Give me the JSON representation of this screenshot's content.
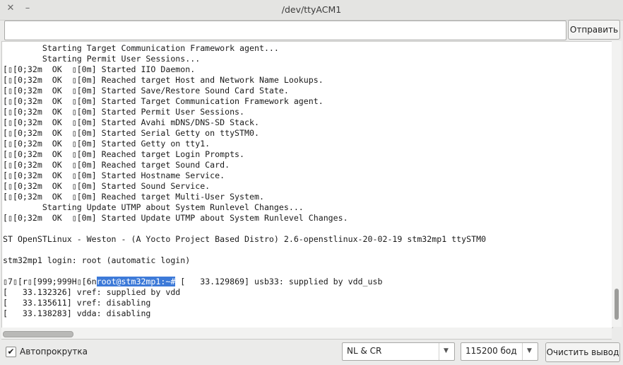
{
  "window": {
    "title": "/dev/ttyACM1",
    "close_glyph": "✕",
    "minimize_glyph": "–"
  },
  "input": {
    "value": "",
    "send_label": "Отправить"
  },
  "console": {
    "lines": [
      "        Starting Target Communication Framework agent...",
      "        Starting Permit User Sessions...",
      "[▯[0;32m  OK  ▯[0m] Started IIO Daemon.",
      "[▯[0;32m  OK  ▯[0m] Reached target Host and Network Name Lookups.",
      "[▯[0;32m  OK  ▯[0m] Started Save/Restore Sound Card State.",
      "[▯[0;32m  OK  ▯[0m] Started Target Communication Framework agent.",
      "[▯[0;32m  OK  ▯[0m] Started Permit User Sessions.",
      "[▯[0;32m  OK  ▯[0m] Started Avahi mDNS/DNS-SD Stack.",
      "[▯[0;32m  OK  ▯[0m] Started Serial Getty on ttySTM0.",
      "[▯[0;32m  OK  ▯[0m] Started Getty on tty1.",
      "[▯[0;32m  OK  ▯[0m] Reached target Login Prompts.",
      "[▯[0;32m  OK  ▯[0m] Reached target Sound Card.",
      "[▯[0;32m  OK  ▯[0m] Started Hostname Service.",
      "[▯[0;32m  OK  ▯[0m] Started Sound Service.",
      "[▯[0;32m  OK  ▯[0m] Reached target Multi-User System.",
      "        Starting Update UTMP about System Runlevel Changes...",
      "[▯[0;32m  OK  ▯[0m] Started Update UTMP about System Runlevel Changes.",
      "",
      "ST OpenSTLinux - Weston - (A Yocto Project Based Distro) 2.6-openstlinux-20-02-19 stm32mp1 ttySTM0",
      "",
      "stm32mp1 login: root (automatic login)",
      ""
    ],
    "prompt_prefix": "▯7▯[r▯[999;999H▯[6n",
    "prompt_selected": "root@stm32mp1:~#",
    "prompt_suffix": " [   33.129869] usb33: supplied by vdd_usb",
    "tail_lines": [
      "[   33.132326] vref: supplied by vdd",
      "[   33.135611] vref: disabling",
      "[   33.138283] vdda: disabling"
    ]
  },
  "footer": {
    "autoscroll_checked": true,
    "autoscroll_label": "Автопрокрутка",
    "check_glyph": "✔",
    "line_ending": "NL & CR",
    "baud_rate": "115200 бод",
    "dropdown_glyph": "▼",
    "clear_label": "Очистить вывод"
  }
}
